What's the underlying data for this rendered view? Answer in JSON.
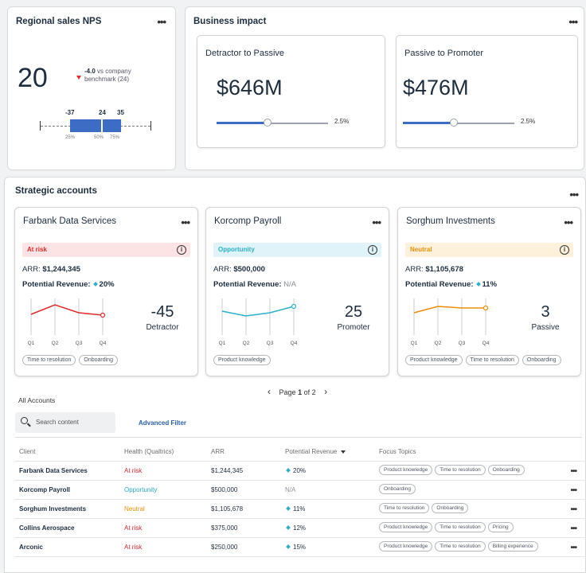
{
  "nps": {
    "title": "Regional sales NPS",
    "score": "20",
    "delta": "-4.0",
    "delta_text": "vs company",
    "benchmark": "benchmark (24)",
    "box_labels": [
      "-37",
      "24",
      "35"
    ],
    "pct_labels": [
      "25%",
      "50%",
      "75%"
    ]
  },
  "impact": {
    "title": "Business impact",
    "cards": [
      {
        "title": "Detractor to Passive",
        "value": "$646M",
        "slider_value": "2.5%",
        "slider_level": 0.46
      },
      {
        "title": "Passive to Promoter",
        "value": "$476M",
        "slider_value": "2.5%",
        "slider_level": 0.46
      }
    ]
  },
  "strategic": {
    "title": "Strategic accounts",
    "accounts": [
      {
        "name": "Farbank Data Services",
        "status": "At risk",
        "arr_label": "ARR:",
        "arr": "$1,244,345",
        "pot_label": "Potential Revenue:",
        "pot": "20%",
        "score": "-45",
        "category": "Detractor",
        "quarters": [
          "Q1",
          "Q2",
          "Q3",
          "Q4"
        ],
        "trend": [
          38,
          50,
          40,
          37
        ],
        "tags": [
          "Time to resolution",
          "Onboarding"
        ],
        "color": "#e0292b",
        "bg": "#fde4e4"
      },
      {
        "name": "Korcomp Payroll",
        "status": "Opportunity",
        "arr_label": "ARR:",
        "arr": "$500,000",
        "pot_label": "Potential Revenue:",
        "pot": "N/A",
        "score": "25",
        "category": "Promoter",
        "quarters": [
          "Q1",
          "Q2",
          "Q3",
          "Q4"
        ],
        "trend": [
          42,
          36,
          40,
          48
        ],
        "tags": [
          "Product knowledge"
        ],
        "color": "#2bb0c6",
        "bg": "#dff3f8"
      },
      {
        "name": "Sorghum Investments",
        "status": "Neutral",
        "arr_label": "ARR:",
        "arr": "$1,105,678",
        "pot_label": "Potential Revenue:",
        "pot": "11%",
        "score": "3",
        "category": "Passive",
        "quarters": [
          "Q1",
          "Q2",
          "Q3",
          "Q4"
        ],
        "trend": [
          40,
          48,
          46,
          46
        ],
        "tags": [
          "Product knowledge",
          "Time to resolution",
          "Onboarding"
        ],
        "color": "#e8900c",
        "bg": "#fdf1dc"
      }
    ],
    "pager": {
      "prefix": "Page",
      "current": "1",
      "of_text": "of 2"
    }
  },
  "all_accounts": {
    "title": "All Accounts",
    "search_placeholder": "Search content",
    "advanced_filter": "Advanced Filter",
    "columns": [
      "Client",
      "Health (Qualtrics)",
      "ARR",
      "Potential Revenue",
      "Focus Topics"
    ],
    "rows": [
      {
        "client": "Farbank Data Services",
        "health": "At risk",
        "health_class": "red",
        "arr": "$1,244,345",
        "pot": "20%",
        "tags": [
          "Product knowledge",
          "Time to resolution",
          "Onboarding"
        ]
      },
      {
        "client": "Korcomp Payroll",
        "health": "Opportunity",
        "health_class": "cyan",
        "arr": "$500,000",
        "pot": "N/A",
        "tags": [
          "Onboarding"
        ]
      },
      {
        "client": "Sorghum Investments",
        "health": "Neutral",
        "health_class": "orange",
        "arr": "$1,105,678",
        "pot": "11%",
        "tags": [
          "Time to resolution",
          "Onboarding"
        ]
      },
      {
        "client": "Collins Aerospace",
        "health": "At risk",
        "health_class": "red",
        "arr": "$375,000",
        "pot": "12%",
        "tags": [
          "Product knowledge",
          "Time to resolution",
          "Pricing"
        ]
      },
      {
        "client": "Arconic",
        "health": "At risk",
        "health_class": "red",
        "arr": "$250,000",
        "pot": "15%",
        "tags": [
          "Product knowledge",
          "Time to resolution",
          "Billing experience"
        ]
      }
    ]
  }
}
